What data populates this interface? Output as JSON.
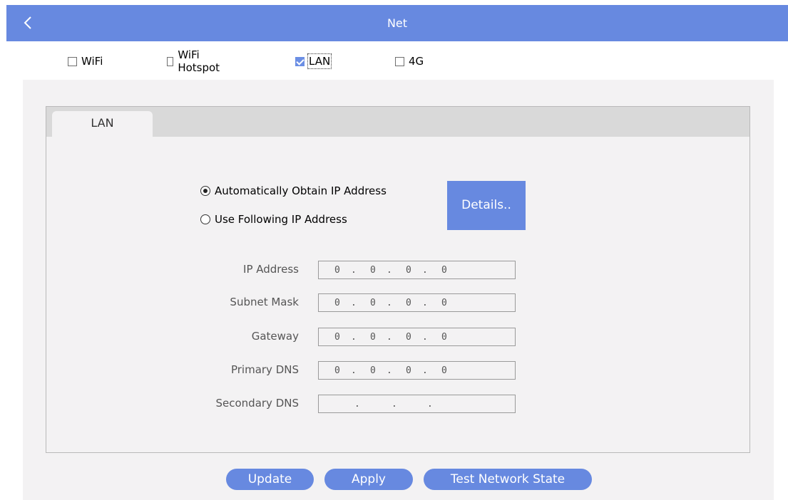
{
  "header": {
    "title": "Net",
    "back_icon": "chevron-left-icon"
  },
  "network_types": [
    {
      "label": "WiFi",
      "checked": false
    },
    {
      "label": "WiFi Hotspot",
      "checked": false
    },
    {
      "label": "LAN",
      "checked": true
    },
    {
      "label": "4G",
      "checked": false
    }
  ],
  "tab": {
    "label": "LAN"
  },
  "ip_mode": {
    "auto_label": "Automatically Obtain IP Address",
    "manual_label": "Use Following IP Address",
    "selected": "auto"
  },
  "details_label": "Details..",
  "fields": [
    {
      "label": "IP Address",
      "octets": [
        "0",
        "0",
        "0",
        "0"
      ]
    },
    {
      "label": "Subnet Mask",
      "octets": [
        "0",
        "0",
        "0",
        "0"
      ]
    },
    {
      "label": "Gateway",
      "octets": [
        "0",
        "0",
        "0",
        "0"
      ]
    },
    {
      "label": "Primary DNS",
      "octets": [
        "0",
        "0",
        "0",
        "0"
      ]
    },
    {
      "label": "Secondary DNS",
      "octets": [
        "",
        "",
        "",
        ""
      ]
    }
  ],
  "ip_separator": ".",
  "actions": {
    "update_label": "Update",
    "apply_label": "Apply",
    "test_label": "Test Network State"
  },
  "colors": {
    "accent": "#6789e0",
    "panel_bg": "#f3f2f3",
    "tabstrip_bg": "#d9d9d9"
  }
}
